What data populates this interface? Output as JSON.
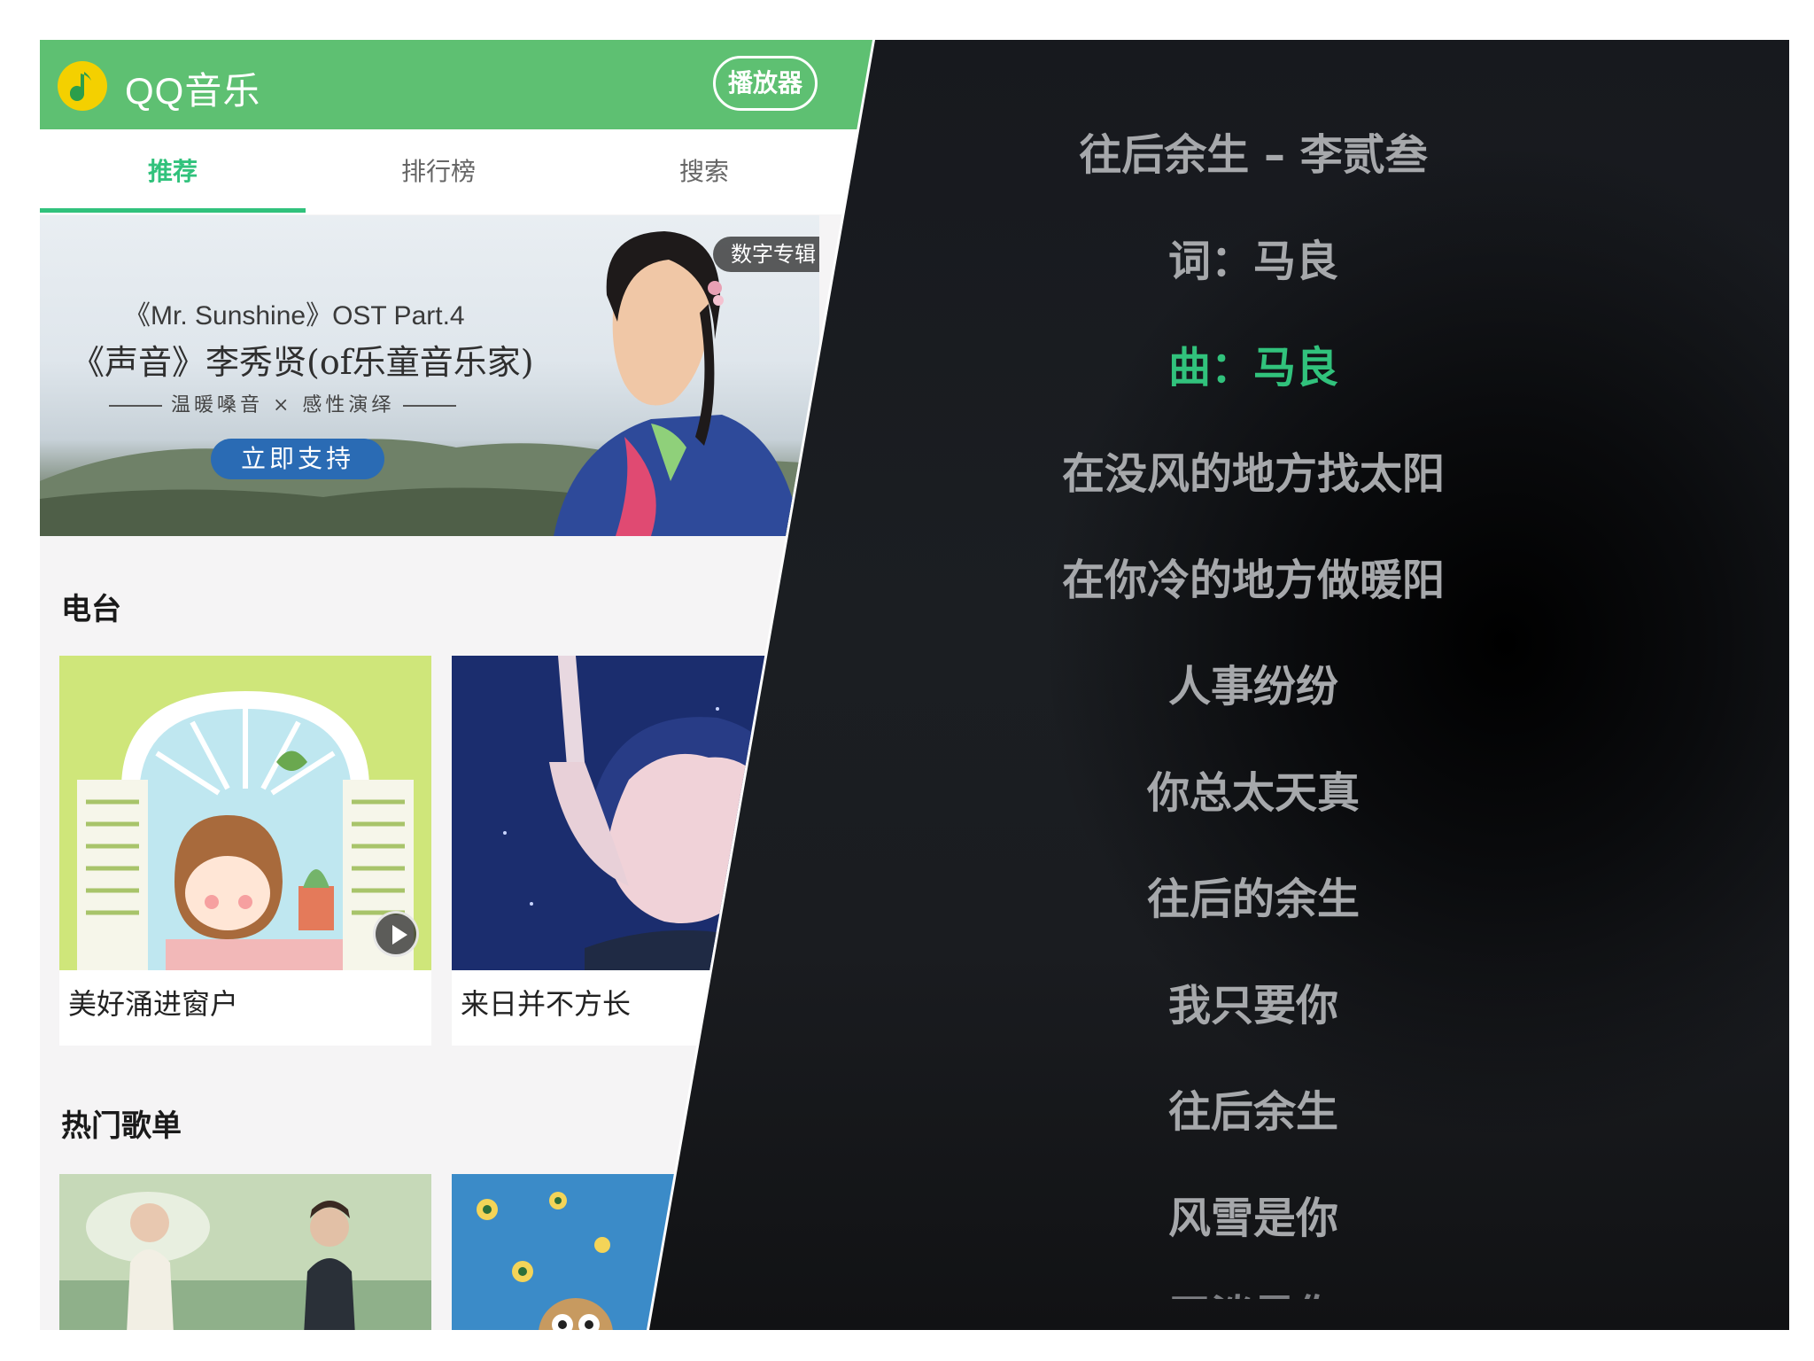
{
  "app": {
    "logo_text": "QQ音乐",
    "player_button": "播放器",
    "brand_color": "#5ec072",
    "accent_color": "#31c27c",
    "tabs": [
      {
        "label": "推荐",
        "active": true
      },
      {
        "label": "排行榜",
        "active": false
      },
      {
        "label": "搜索",
        "active": false
      }
    ],
    "banner": {
      "line1": "《Mr. Sunshine》OST Part.4",
      "line2": "《声音》李秀贤(of乐童音乐家)",
      "line3": "温暖嗓音 × 感性演绎",
      "cta": "立即支持",
      "tag": "数字专辑"
    },
    "radio": {
      "title": "电台",
      "items": [
        {
          "label": "美好涌进窗户",
          "icon": "play-icon"
        },
        {
          "label": "来日并不方长"
        }
      ]
    },
    "playlists": {
      "title": "热门歌单"
    }
  },
  "lyrics": {
    "lines": [
      {
        "text": "往后余生 – 李贰叁",
        "active": false
      },
      {
        "text": "词：马良",
        "active": false
      },
      {
        "text": "曲：马良",
        "active": true
      },
      {
        "text": "在没风的地方找太阳",
        "active": false
      },
      {
        "text": "在你冷的地方做暖阳",
        "active": false
      },
      {
        "text": "人事纷纷",
        "active": false
      },
      {
        "text": "你总太天真",
        "active": false
      },
      {
        "text": "往后的余生",
        "active": false
      },
      {
        "text": "我只要你",
        "active": false
      },
      {
        "text": "往后余生",
        "active": false
      },
      {
        "text": "风雪是你",
        "active": false
      },
      {
        "text": "平淡是你",
        "active": false
      }
    ]
  }
}
